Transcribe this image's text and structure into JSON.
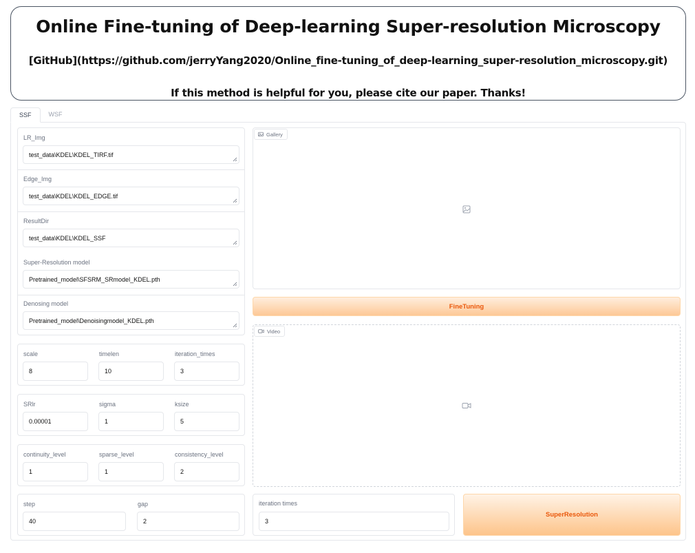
{
  "header": {
    "title": "Online Fine-tuning of Deep-learning Super-resolution Microscopy",
    "github_link": "[GitHub](https://github.com/jerryYang2020/Online_fine-tuning_of_deep-learning_super-resolution_microscopy.git)",
    "cite": "If this method is helpful for you, please cite our paper. Thanks!"
  },
  "tabs": [
    {
      "label": "SSF",
      "active": true
    },
    {
      "label": "WSF",
      "active": false
    }
  ],
  "paths": {
    "lr_img": {
      "label": "LR_Img",
      "value": "test_data\\KDEL\\KDEL_TIRF.tif"
    },
    "edge_img": {
      "label": "Edge_Img",
      "value": "test_data\\KDEL\\KDEL_EDGE.tif"
    },
    "result_dir": {
      "label": "ResultDir",
      "value": "test_data\\KDEL\\KDEL_SSF"
    },
    "sr_model": {
      "label": "Super-Resolution model",
      "value": "Pretrained_model\\SFSRM_SRmodel_KDEL.pth"
    },
    "denoise_model": {
      "label": "Denosing model",
      "value": "Pretrained_model\\Denoisingmodel_KDEL.pth"
    }
  },
  "params1": {
    "scale": {
      "label": "scale",
      "value": "8"
    },
    "timelen": {
      "label": "timelen",
      "value": "10"
    },
    "iteration_times": {
      "label": "iteration_times",
      "value": "3"
    }
  },
  "params2": {
    "srlr": {
      "label": "SRlr",
      "value": "0.00001"
    },
    "sigma": {
      "label": "sigma",
      "value": "1"
    },
    "ksize": {
      "label": "ksize",
      "value": "5"
    }
  },
  "params3": {
    "continuity_level": {
      "label": "continuity_level",
      "value": "1"
    },
    "sparse_level": {
      "label": "sparse_level",
      "value": "1"
    },
    "consistency_level": {
      "label": "consistency_level",
      "value": "2"
    }
  },
  "params4": {
    "step": {
      "label": "step",
      "value": "40"
    },
    "gap": {
      "label": "gap",
      "value": "2"
    }
  },
  "gallery": {
    "label": "Gallery",
    "icon": "image-icon"
  },
  "video": {
    "label": "Video",
    "icon": "video-camera-icon"
  },
  "finetuning_button": "FineTuning",
  "sr_iteration": {
    "label": "iteration times",
    "value": "3"
  },
  "superresolution_button": "SuperResolution",
  "colors": {
    "accent": "#ea580c",
    "button_top": "#fff3e6",
    "button_bottom": "#fdc48a",
    "border": "#e5e7eb"
  }
}
